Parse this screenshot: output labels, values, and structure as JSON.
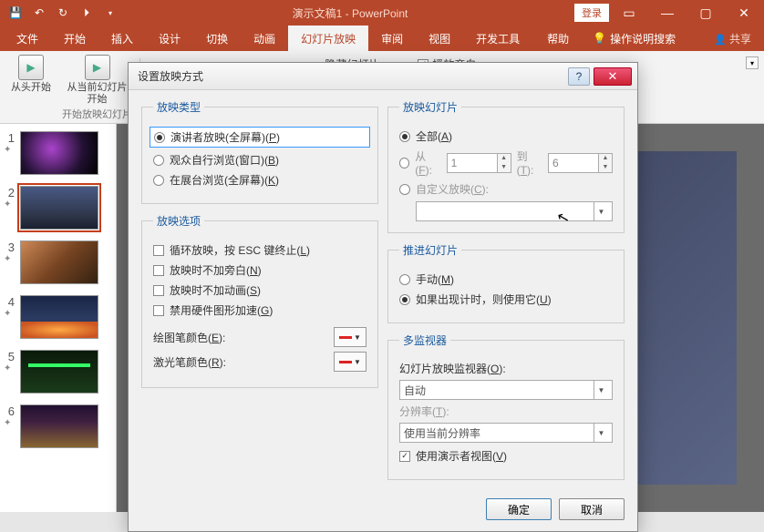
{
  "titlebar": {
    "title": "演示文稿1 - PowerPoint",
    "login": "登录"
  },
  "tabs": {
    "file": "文件",
    "home": "开始",
    "insert": "插入",
    "design": "设计",
    "transitions": "切换",
    "animations": "动画",
    "slideshow": "幻灯片放映",
    "review": "审阅",
    "view": "视图",
    "developer": "开发工具",
    "help": "帮助",
    "tellme": "操作说明搜索",
    "share": "共享"
  },
  "ribbon": {
    "from_begin": "从头开始",
    "from_current": "从当前幻灯片\n开始",
    "start_group": "开始放映幻灯片",
    "hide_slide": "隐藏幻灯片",
    "narration": "播放旁白"
  },
  "thumbs": {
    "n1": "1",
    "n2": "2",
    "n3": "3",
    "n4": "4",
    "n5": "5",
    "n6": "6",
    "star": "✦"
  },
  "dialog": {
    "title": "设置放映方式",
    "show_type": "放映类型",
    "presenter": "演讲者放映(全屏幕)(P)",
    "browsed_individual": "观众自行浏览(窗口)(B)",
    "kiosk": "在展台浏览(全屏幕)(K)",
    "show_options": "放映选项",
    "loop": "循环放映，按 ESC 键终止(L)",
    "no_narration": "放映时不加旁白(N)",
    "no_animation": "放映时不加动画(S)",
    "disable_hw": "禁用硬件图形加速(G)",
    "pen_color": "绘图笔颜色(E):",
    "laser_color": "激光笔颜色(R):",
    "show_slides": "放映幻灯片",
    "all": "全部(A)",
    "from": "从(F):",
    "from_val": "1",
    "to": "到(T):",
    "to_val": "6",
    "custom": "自定义放映(C):",
    "advance": "推进幻灯片",
    "manual": "手动(M)",
    "timings": "如果出现计时，则使用它(U)",
    "multi": "多监视器",
    "monitor_label": "幻灯片放映监视器(O):",
    "monitor_val": "自动",
    "res_label": "分辨率(T):",
    "res_val": "使用当前分辨率",
    "presenter_view": "使用演示者视图(V)",
    "ok": "确定",
    "cancel": "取消"
  }
}
